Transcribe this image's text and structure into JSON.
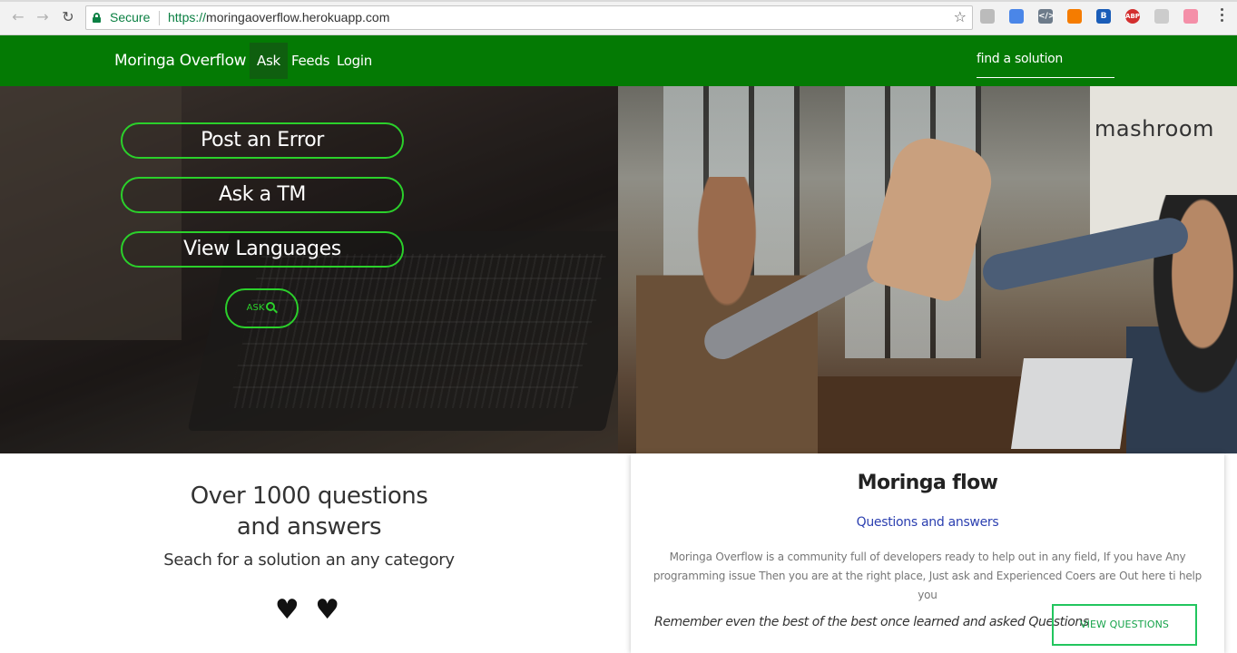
{
  "browser": {
    "secure_label": "Secure",
    "url_scheme": "https://",
    "url_host": "moringaoverflow.herokuapp.com",
    "back_icon": "arrow-left-icon",
    "forward_icon": "arrow-right-icon",
    "reload_icon": "reload-icon",
    "star_icon": "bookmark-star-icon",
    "extensions": [
      {
        "name": "zoom-icon",
        "label": "",
        "color": "#bbbbbb"
      },
      {
        "name": "translate-icon",
        "label": "",
        "color": "#4a86e8"
      },
      {
        "name": "code-icon",
        "label": "</>",
        "color": "#6d7b8a"
      },
      {
        "name": "hangout-icon",
        "label": "",
        "color": "#f57c00"
      },
      {
        "name": "b-icon",
        "label": "B",
        "color": "#1a5db8"
      },
      {
        "name": "abp-icon",
        "label": "ABP",
        "color": "#d32f2f"
      },
      {
        "name": "grey-extension-icon",
        "label": "",
        "color": "#cccccc"
      },
      {
        "name": "pink-extension-icon",
        "label": "",
        "color": "#f48fa8"
      }
    ]
  },
  "navbar": {
    "brand": "Moringa Overflow",
    "links": [
      {
        "label": "Ask",
        "active": true
      },
      {
        "label": "Feeds",
        "active": false
      },
      {
        "label": "Login",
        "active": false
      }
    ],
    "search_placeholder": "find a solution",
    "bg_color": "#047a04"
  },
  "hero": {
    "buttons": [
      "Post an Error",
      "Ask a TM",
      "View Languages"
    ],
    "ask_label": "ASK",
    "accent_color": "#2bd02b",
    "right_image_text": "mashroom"
  },
  "info": {
    "title": "Over 1000 questions and answers",
    "subtitle": "Seach for a solution an any category",
    "hearts": "♥ ♥"
  },
  "card": {
    "title": "Moringa flow",
    "subtitle": "Questions and answers",
    "description": "Moringa Overflow is a community full of developers ready to help out in any field, If you have Any programming issue Then you are at the right place, Just ask and Experienced Coers are Out here ti help you",
    "quote": "Remember even the best of the best once learned and asked Questions",
    "button_label": "VIEW QUESTIONS"
  }
}
